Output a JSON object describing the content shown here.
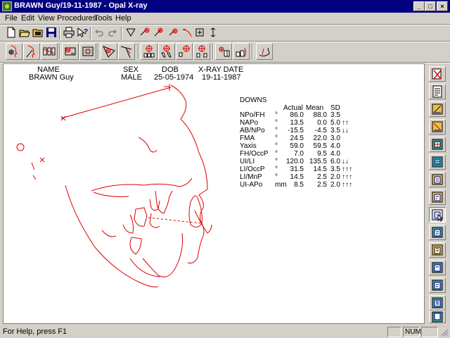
{
  "window": {
    "title": "BRAWN Guy/19-11-1987 - Opal X-ray",
    "controls": [
      "minimize",
      "maximize",
      "close"
    ]
  },
  "menu": [
    "File",
    "Edit",
    "View",
    "Procedures",
    "Tools",
    "Help"
  ],
  "toolbar1": {
    "icons": [
      "new-file-icon",
      "open-file-icon",
      "open-folder-icon",
      "save-icon",
      "print-icon",
      "help-pointer-icon",
      "undo-icon",
      "redo-icon",
      "trace-tool-icon",
      "landmark-tool-1-icon",
      "landmark-tool-2-icon",
      "landmark-tool-3-icon",
      "curve-tool-icon",
      "measure-tool-icon",
      "rotate-tool-icon"
    ]
  },
  "toolbar2": {
    "icons": [
      "face-profile-icon",
      "face-landmark-icon",
      "teeth-icon",
      "skull-front-icon",
      "skull-grid-icon",
      "sella-icon",
      "ruler-angle-icon",
      "tooth-crosshair-1-icon",
      "tooth-crosshair-2-icon",
      "tooth-crosshair-3-icon",
      "tooth-crosshair-4-icon",
      "incisor-icon",
      "molar-icon",
      "jaw-icon"
    ]
  },
  "patient": {
    "headers": [
      "NAME",
      "SEX",
      "DOB",
      "X-RAY DATE"
    ],
    "values": [
      "BRAWN Guy",
      "MALE",
      "25-05-1974",
      "19-11-1987"
    ]
  },
  "analysis": {
    "title": "DOWNS",
    "columns": [
      "Actual",
      "Mean",
      "SD"
    ],
    "rows": [
      {
        "name": "NPo/FH",
        "unit": "°",
        "actual": "86.0",
        "mean": "88.0",
        "sd": "3.5",
        "flag": ""
      },
      {
        "name": "NAPo",
        "unit": "°",
        "actual": "13.5",
        "mean": "0.0",
        "sd": "5.0",
        "flag": "↑↑"
      },
      {
        "name": "AB/NPo",
        "unit": "°",
        "actual": "-15.5",
        "mean": "-4.5",
        "sd": "3.5",
        "flag": "↓↓"
      },
      {
        "name": "FMA",
        "unit": "°",
        "actual": "24.5",
        "mean": "22.0",
        "sd": "3.0",
        "flag": ""
      },
      {
        "name": "Yaxis",
        "unit": "°",
        "actual": "59.0",
        "mean": "59.5",
        "sd": "4.0",
        "flag": ""
      },
      {
        "name": "FH/OccP",
        "unit": "°",
        "actual": "7.0",
        "mean": "9.5",
        "sd": "4.0",
        "flag": ""
      },
      {
        "name": "UI/LI",
        "unit": "°",
        "actual": "120.0",
        "mean": "135.5",
        "sd": "6.0",
        "flag": "↓↓"
      },
      {
        "name": "LI/OccP",
        "unit": "°",
        "actual": "31.5",
        "mean": "14.5",
        "sd": "3.5",
        "flag": "↑↑↑"
      },
      {
        "name": "LI/MnP",
        "unit": "°",
        "actual": "14.5",
        "mean": "2.5",
        "sd": "2.0",
        "flag": "↑↑↑"
      },
      {
        "name": "UI-APo",
        "unit": "mm",
        "actual": "8.5",
        "mean": "2.5",
        "sd": "2.0",
        "flag": "↑↑↑"
      }
    ]
  },
  "right_toolbar": {
    "icons": [
      "tool-delete-icon",
      "tool-doc-icon",
      "tool-angle-1-icon",
      "tool-angle-2-icon",
      "tool-grid-icon",
      "tool-panel-icon",
      "tool-report-1-icon",
      "tool-report-2-icon",
      "tool-report-3-icon",
      "tool-report-4-icon",
      "tool-report-5-icon",
      "tool-report-6-icon",
      "tool-report-7-icon",
      "tool-report-8-icon",
      "tool-report-9-icon"
    ],
    "pressed_index": 8
  },
  "status": {
    "text": "For Help, press F1",
    "num": "NUM"
  },
  "colors": {
    "titlebar": "#000080",
    "trace": "#e00000",
    "face": "#d4d0c8"
  }
}
